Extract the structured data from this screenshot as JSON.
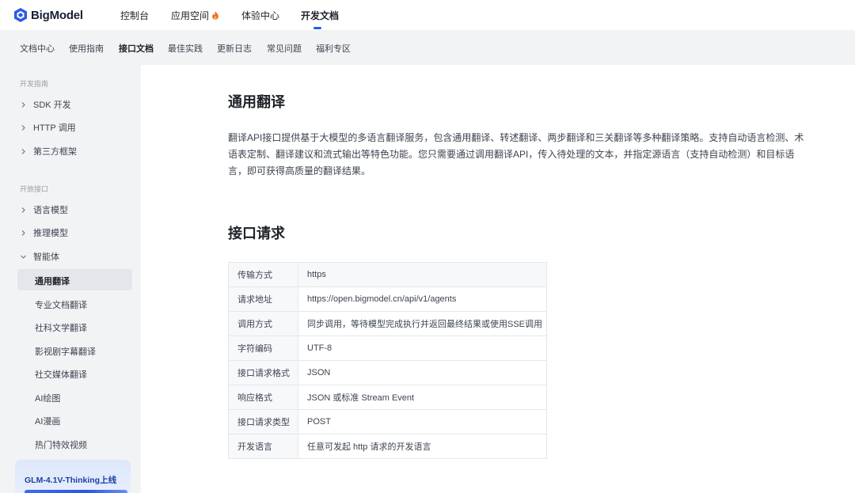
{
  "brand": {
    "name": "BigModel"
  },
  "topnav": {
    "items": [
      {
        "label": "控制台"
      },
      {
        "label": "应用空间"
      },
      {
        "label": "体验中心"
      },
      {
        "label": "开发文档"
      }
    ],
    "active": "开发文档"
  },
  "subnav": {
    "items": [
      {
        "label": "文档中心"
      },
      {
        "label": "使用指南"
      },
      {
        "label": "接口文档"
      },
      {
        "label": "最佳实践"
      },
      {
        "label": "更新日志"
      },
      {
        "label": "常见问题"
      },
      {
        "label": "福利专区"
      }
    ],
    "active": "接口文档"
  },
  "sidebar": {
    "sections": [
      {
        "title": "开发指南"
      },
      {
        "title": "开放接口"
      }
    ],
    "items": [
      {
        "label": "SDK 开发"
      },
      {
        "label": "HTTP 调用"
      },
      {
        "label": "第三方框架"
      },
      {
        "label": "语言模型"
      },
      {
        "label": "推理模型"
      },
      {
        "label": "智能体"
      }
    ],
    "subitems": [
      {
        "label": "通用翻译"
      },
      {
        "label": "专业文档翻译"
      },
      {
        "label": "社科文学翻译"
      },
      {
        "label": "影视剧字幕翻译"
      },
      {
        "label": "社交媒体翻译"
      },
      {
        "label": "AI绘图"
      },
      {
        "label": "AI漫画"
      },
      {
        "label": "热门特效视频"
      }
    ],
    "active": "通用翻译",
    "promo": {
      "text": "GLM-4.1V-Thinking上线"
    }
  },
  "main": {
    "title": "通用翻译",
    "intro": "翻译API接口提供基于大模型的多语言翻译服务，包含通用翻译、转述翻译、两步翻译和三关翻译等多种翻译策略。支持自动语言检测、术语表定制、翻译建议和流式输出等特色功能。您只需要通过调用翻译API，传入待处理的文本，并指定源语言（支持自动检测）和目标语言，即可获得高质量的翻译结果。",
    "section_title": "接口请求",
    "spec_rows": [
      {
        "key": "传输方式",
        "value": "https"
      },
      {
        "key": "请求地址",
        "value": "https://open.bigmodel.cn/api/v1/agents"
      },
      {
        "key": "调用方式",
        "value": "同步调用，等待模型完成执行并返回最终结果或使用SSE调用"
      },
      {
        "key": "字符编码",
        "value": "UTF-8"
      },
      {
        "key": "接口请求格式",
        "value": "JSON"
      },
      {
        "key": "响应格式",
        "value": "JSON 或标准 Stream Event"
      },
      {
        "key": "接口请求类型",
        "value": "POST"
      },
      {
        "key": "开发语言",
        "value": "任意可发起 http 请求的开发语言"
      }
    ]
  },
  "colors": {
    "accent": "#1a5ff0",
    "sidebar_bg": "#f2f3f5",
    "promo_text": "#1a3fa8"
  },
  "icons": [
    "bigmodel-logo-icon",
    "fire-icon",
    "chevron-right-icon",
    "chevron-down-icon"
  ]
}
